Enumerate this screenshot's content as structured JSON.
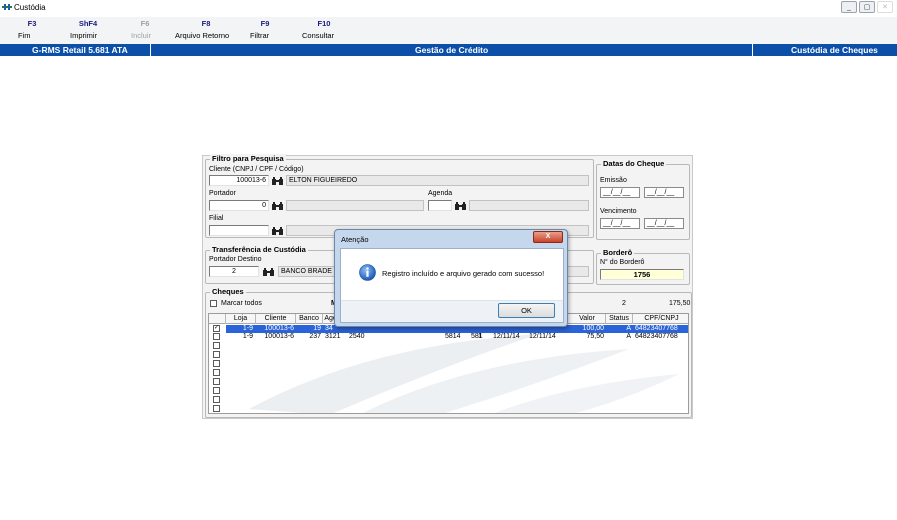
{
  "window": {
    "title": "Custódia",
    "controls": [
      "_",
      "▢",
      "✕"
    ]
  },
  "toolbar": [
    {
      "key": "F3",
      "label": "Fim",
      "enabled": true
    },
    {
      "key": "ShF4",
      "label": "Imprimir",
      "enabled": true
    },
    {
      "key": "F6",
      "label": "Incluir",
      "enabled": false
    },
    {
      "key": "F8",
      "label": "Arquivo Retorno",
      "enabled": true
    },
    {
      "key": "F9",
      "label": "Filtrar",
      "enabled": true
    },
    {
      "key": "F10",
      "label": "Consultar",
      "enabled": true
    }
  ],
  "header": {
    "left": "G-RMS Retail 5.681 ATA",
    "center": "Gestão de Crédito",
    "right": "Custódia de Cheques"
  },
  "filtro": {
    "title": "Filtro para Pesquisa",
    "cliente_label": "Cliente (CNPJ / CPF / Código)",
    "cliente_code": "100013-6",
    "cliente_name": "ELTON FIGUEIREDO",
    "portador_label": "Portador",
    "portador_value": "0",
    "agenda_label": "Agenda",
    "filial_label": "Filial"
  },
  "datas": {
    "title": "Datas do Cheque",
    "emissao_label": "Emissão",
    "vencimento_label": "Vencimento",
    "date_placeholder": "__/__/__"
  },
  "transferencia": {
    "title": "Transferência de Custódia",
    "portador_destino_label": "Portador Destino",
    "portador_destino_value": "2",
    "banco_name": "BANCO BRADE"
  },
  "bordero": {
    "title": "Borderô",
    "numero_label": "N° do Borderô",
    "numero_value": "1756"
  },
  "cheques": {
    "title": "Cheques",
    "marcar_todos": "Marcar todos",
    "summary_m": "M",
    "summary_count": "2",
    "summary_total": "175,50",
    "columns": [
      "Loja",
      "Cliente",
      "Banco",
      "Agen",
      "Valor",
      "Status",
      "CPF/CNPJ"
    ],
    "rows": [
      {
        "checked": true,
        "selected": true,
        "loja": "1-9",
        "cliente": "100013-6",
        "banco": "19",
        "agencia": "34",
        "valor": "100,00",
        "status": "A",
        "cpf": "64823407768"
      },
      {
        "checked": false,
        "selected": false,
        "loja": "1-9",
        "cliente": "100013-6",
        "banco": "237",
        "agencia": "3121",
        "conta": "2540",
        "numero": "5814",
        "serie": "1",
        "c": "581",
        "emissao": "12/11/14",
        "vencimento": "12/11/14",
        "valor": "75,50",
        "status": "A",
        "cpf": "64823407768"
      }
    ],
    "empty_rows": 8
  },
  "dialog": {
    "title": "Atenção",
    "close": "X",
    "message": "Registro incluído e arquivo gerado com sucesso!",
    "ok_label": "OK"
  },
  "colors": {
    "header_blue": "#0b4fa8",
    "selection_blue": "#2b63d8",
    "bordero_yellow": "#ffffd8"
  }
}
